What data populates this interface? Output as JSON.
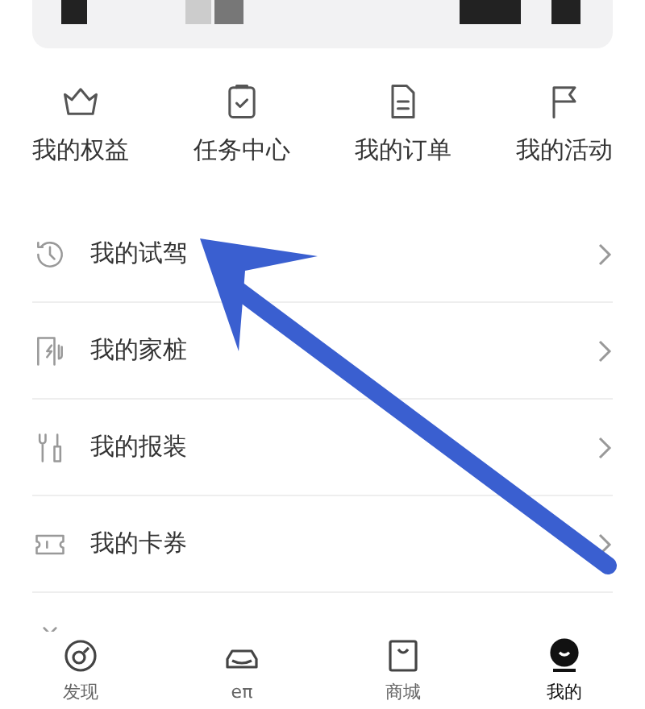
{
  "shortcuts": [
    {
      "label": "我的权益",
      "kind": "crown"
    },
    {
      "label": "任务中心",
      "kind": "clipboard"
    },
    {
      "label": "我的订单",
      "kind": "document"
    },
    {
      "label": "我的活动",
      "kind": "flag"
    }
  ],
  "menu": [
    {
      "label": "我的试驾",
      "kind": "history"
    },
    {
      "label": "我的家桩",
      "kind": "charger"
    },
    {
      "label": "我的报装",
      "kind": "tools"
    },
    {
      "label": "我的卡券",
      "kind": "ticket"
    }
  ],
  "tab_bar": [
    {
      "label": "发现",
      "kind": "discover",
      "selected": false
    },
    {
      "label": "eπ",
      "kind": "car",
      "selected": false
    },
    {
      "label": "商城",
      "kind": "bag",
      "selected": false
    },
    {
      "label": "我的",
      "kind": "profile",
      "selected": true
    }
  ]
}
